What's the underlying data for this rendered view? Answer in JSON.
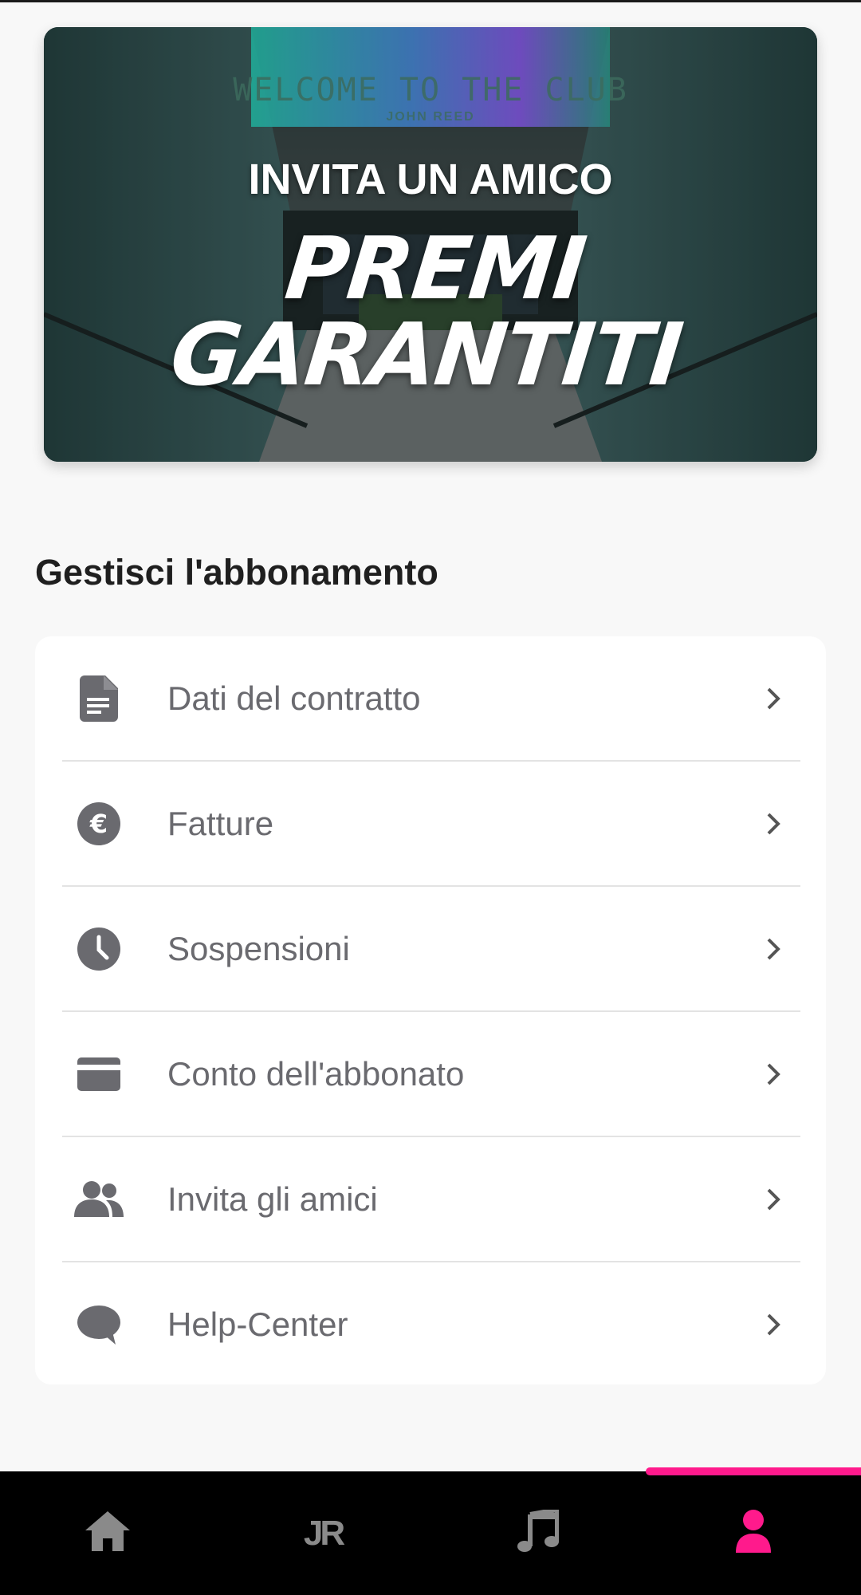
{
  "banner": {
    "sign_text": "WELCOME TO THE CLUB",
    "sign_sub": "JOHN REED",
    "title": "INVITA UN AMICO",
    "subtitle": "PREMI GARANTITI"
  },
  "section": {
    "title": "Gestisci l'abbonamento"
  },
  "menu": {
    "items": [
      {
        "label": "Dati del contratto",
        "icon": "document-icon"
      },
      {
        "label": "Fatture",
        "icon": "euro-icon"
      },
      {
        "label": "Sospensioni",
        "icon": "clock-icon"
      },
      {
        "label": "Conto dell'abbonato",
        "icon": "credit-card-icon"
      },
      {
        "label": "Invita gli amici",
        "icon": "people-icon"
      },
      {
        "label": "Help-Center",
        "icon": "chat-bubble-icon"
      }
    ]
  },
  "bottom_nav": {
    "items": [
      {
        "name": "home",
        "icon": "home-icon",
        "active": false
      },
      {
        "name": "jr",
        "icon": "jr-logo",
        "label": "JR",
        "active": false
      },
      {
        "name": "music",
        "icon": "music-note-icon",
        "active": false
      },
      {
        "name": "profile",
        "icon": "person-icon",
        "active": true
      }
    ],
    "active_color": "#ff1a8c",
    "inactive_color": "#8a8a8a"
  },
  "colors": {
    "icon_gray": "#6a6a6f",
    "accent": "#ff1a8c"
  }
}
